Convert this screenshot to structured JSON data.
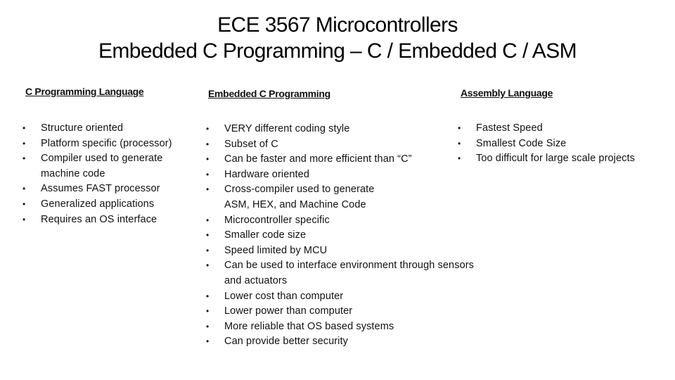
{
  "title": {
    "line1": "ECE 3567 Microcontrollers",
    "line2": "Embedded C Programming – C / Embedded C / ASM"
  },
  "columns": [
    {
      "heading": "C Programming Language",
      "items": [
        "Structure oriented",
        "Platform specific (processor)",
        "Compiler used to generate",
        "machine code",
        "Assumes FAST processor",
        "Generalized applications",
        "Requires an OS interface"
      ],
      "bulleted": [
        true,
        true,
        true,
        false,
        true,
        true,
        true
      ]
    },
    {
      "heading": "Embedded C Programming",
      "items": [
        "VERY different coding style",
        "Subset of C",
        "Can be faster and more efficient than “C”",
        "Hardware oriented",
        "Cross-compiler used to generate",
        "ASM, HEX, and Machine Code",
        "Microcontroller specific",
        "Smaller code size",
        "Speed limited by MCU",
        "Can be used to interface environment through sensors",
        "and actuators",
        "Lower cost than computer",
        "Lower power than computer",
        "More reliable that OS based systems",
        "Can provide better security"
      ],
      "bulleted": [
        true,
        true,
        true,
        true,
        true,
        false,
        true,
        true,
        true,
        true,
        false,
        true,
        true,
        true,
        true
      ]
    },
    {
      "heading": "Assembly Language",
      "items": [
        "Fastest Speed",
        "Smallest Code Size",
        "Too difficult for large scale projects"
      ],
      "bulleted": [
        true,
        true,
        true
      ]
    }
  ],
  "bullet_glyph": "•"
}
